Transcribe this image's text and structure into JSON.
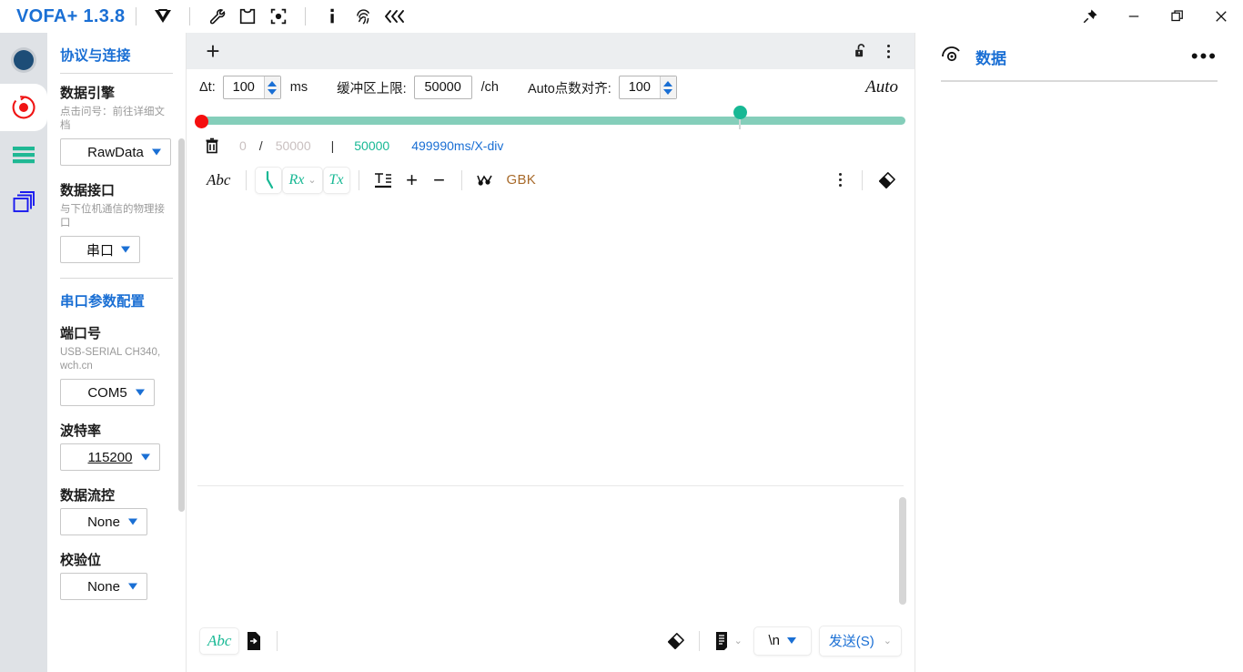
{
  "titlebar": {
    "brand": "VOFA+ 1.3.8",
    "icons": [
      {
        "name": "vofa-logo-icon"
      },
      {
        "name": "wrench-icon"
      },
      {
        "name": "shirt-icon"
      },
      {
        "name": "focus-target-icon"
      },
      {
        "name": "info-icon"
      },
      {
        "name": "fingerprint-icon"
      },
      {
        "name": "collapse-left-icon"
      }
    ],
    "window_controls": [
      {
        "name": "pin-button"
      },
      {
        "name": "minimize-button"
      },
      {
        "name": "maximize-button"
      },
      {
        "name": "close-button"
      }
    ]
  },
  "rail": {
    "items": [
      {
        "name": "connection-status-indicator",
        "active": false
      },
      {
        "name": "record-icon",
        "active": true
      },
      {
        "name": "list-lines-icon",
        "active": false
      },
      {
        "name": "copy-stack-icon",
        "active": false
      }
    ]
  },
  "sidebar": {
    "title": "协议与连接",
    "sections": [
      {
        "label": "数据引擎",
        "hint": "点击问号：前往详细文档",
        "select_value": "RawData",
        "underlined": false
      },
      {
        "label": "数据接口",
        "hint": "与下位机通信的物理接口",
        "select_value": "串口",
        "underlined": false
      }
    ],
    "serial_title": "串口参数配置",
    "serial_fields": [
      {
        "label": "端口号",
        "hint": "USB-SERIAL CH340, wch.cn",
        "value": "COM5",
        "underlined": false
      },
      {
        "label": "波特率",
        "hint": "",
        "value": "115200",
        "underlined": true
      },
      {
        "label": "数据流控",
        "hint": "",
        "value": "None",
        "underlined": false
      },
      {
        "label": "校验位",
        "hint": "",
        "value": "None",
        "underlined": false
      }
    ]
  },
  "main": {
    "tabbar": {
      "add_label": "+",
      "lock_icon": "unlock-icon",
      "menu_icon": "more-vertical-icon"
    },
    "params": {
      "dt_label": "Δt:",
      "dt_value": "100",
      "dt_unit": "ms",
      "buffer_label": "缓冲区上限:",
      "buffer_value": "50000",
      "buffer_unit": "/ch",
      "align_label": "Auto点数对齐:",
      "align_value": "100",
      "auto_label": "Auto"
    },
    "slider": {
      "left_handle_color": "#f50f0f",
      "mid_handle_color": "#17b894",
      "right_handle_color": "#8a16a8",
      "track_color": "#84ceba"
    },
    "status": {
      "trash_icon": "trash-icon",
      "current": "0",
      "divider": "/",
      "total": "50000",
      "bar": "|",
      "count": "50000",
      "timebase": "499990ms/X-div"
    },
    "terminal_tools": {
      "abc_label": "Abc",
      "wave_icon": "curve-icon",
      "rx_label": "Rx",
      "tx_label": "Tx",
      "text_format_icon": "text-format-icon",
      "zoom_in_label": "+",
      "zoom_out_label": "−",
      "signal_icon": "signal-icon",
      "encoding_label": "GBK",
      "menu_icon": "more-vertical-icon",
      "erase_icon": "eraser-icon"
    },
    "send_tools": {
      "abc_label": "Abc",
      "file_send_icon": "file-send-icon",
      "erase_icon": "eraser-icon",
      "doc_icon": "document-icon",
      "newline_value": "\\n",
      "send_label": "发送(S)"
    }
  },
  "right": {
    "icon": "data-scope-icon",
    "title": "数据",
    "menu_label": "•••"
  }
}
